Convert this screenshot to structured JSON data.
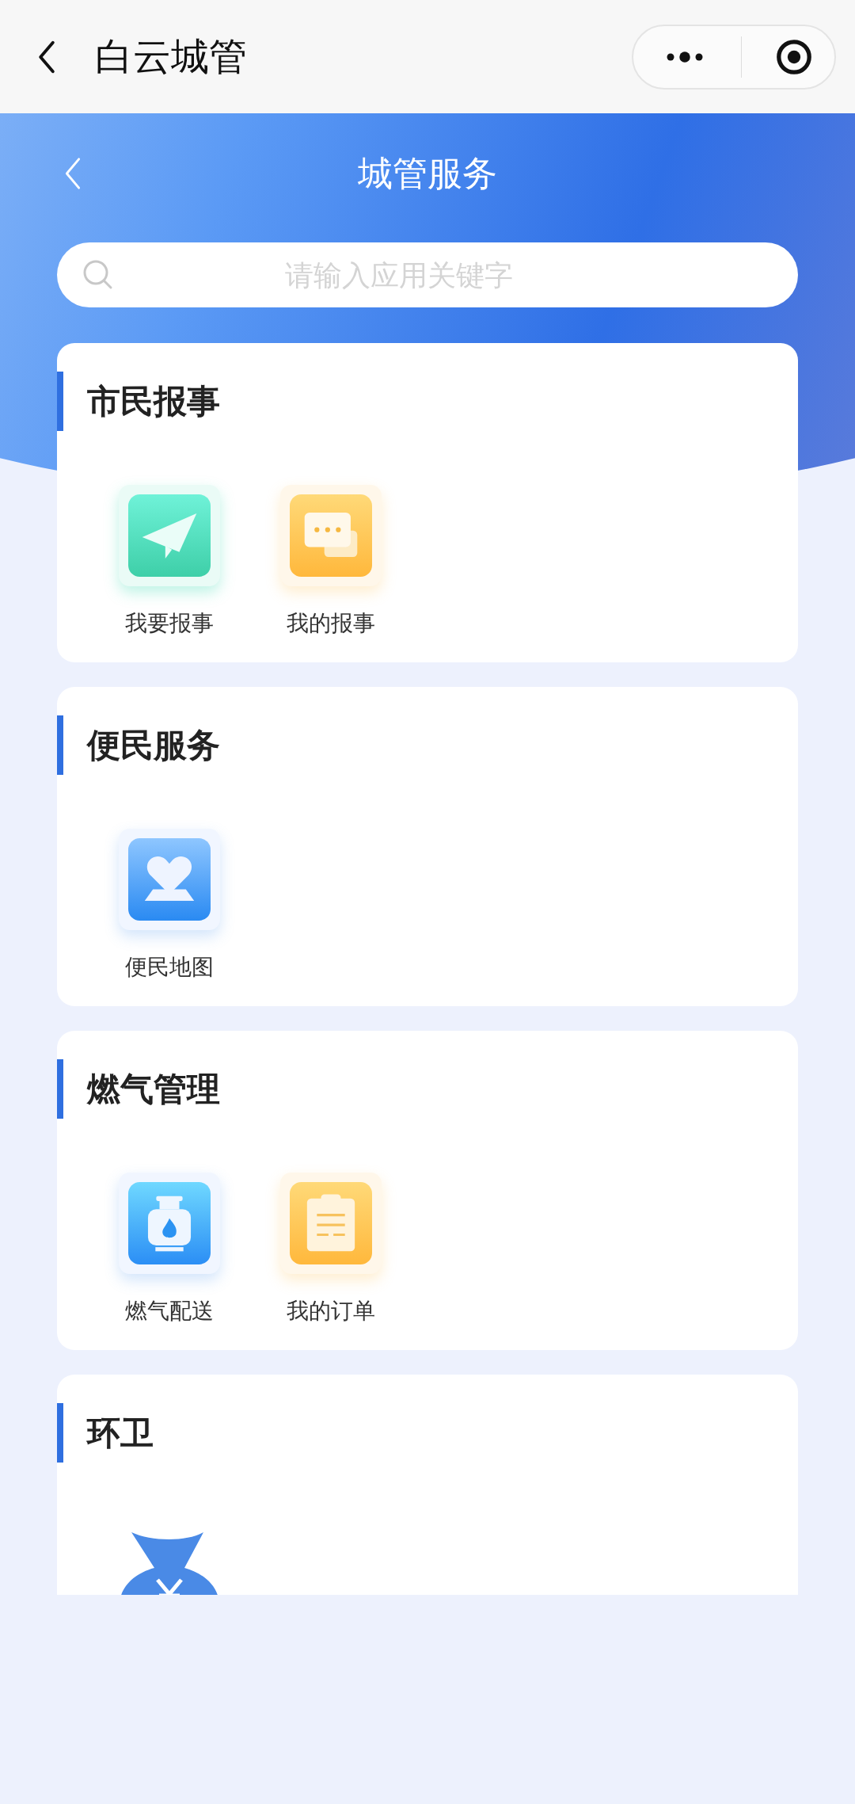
{
  "top_bar": {
    "title": "白云城管"
  },
  "header": {
    "title": "城管服务"
  },
  "search": {
    "placeholder": "请输入应用关键字"
  },
  "sections": [
    {
      "title": "市民报事",
      "items": [
        {
          "kind": "send",
          "label": "我要报事"
        },
        {
          "kind": "chat",
          "label": "我的报事"
        }
      ]
    },
    {
      "title": "便民服务",
      "items": [
        {
          "kind": "map",
          "label": "便民地图"
        }
      ]
    },
    {
      "title": "燃气管理",
      "items": [
        {
          "kind": "gas",
          "label": "燃气配送"
        },
        {
          "kind": "order",
          "label": "我的订单"
        }
      ]
    },
    {
      "title": "环卫",
      "items": [
        {
          "kind": "moneybag"
        }
      ]
    }
  ]
}
